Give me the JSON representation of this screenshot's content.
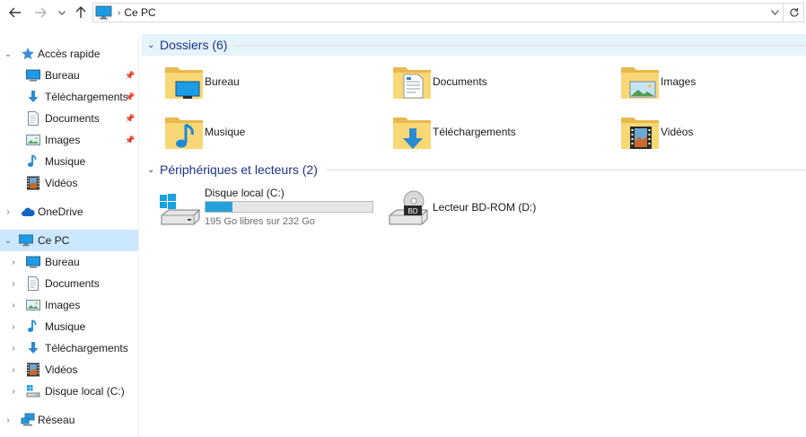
{
  "address": {
    "location": "Ce PC"
  },
  "nav": {
    "quick_access": "Accès rapide",
    "quick_items": [
      {
        "label": "Bureau",
        "icon": "desktop-icon"
      },
      {
        "label": "Téléchargements",
        "icon": "download-icon"
      },
      {
        "label": "Documents",
        "icon": "document-icon"
      },
      {
        "label": "Images",
        "icon": "pictures-icon"
      },
      {
        "label": "Musique",
        "icon": "music-icon"
      },
      {
        "label": "Vidéos",
        "icon": "videos-icon"
      }
    ],
    "onedrive": "OneDrive",
    "this_pc": "Ce PC",
    "pc_items": [
      {
        "label": "Bureau",
        "icon": "desktop-icon"
      },
      {
        "label": "Documents",
        "icon": "document-icon"
      },
      {
        "label": "Images",
        "icon": "pictures-icon"
      },
      {
        "label": "Musique",
        "icon": "music-icon"
      },
      {
        "label": "Téléchargements",
        "icon": "download-icon"
      },
      {
        "label": "Vidéos",
        "icon": "videos-icon"
      },
      {
        "label": "Disque local (C:)",
        "icon": "drive-icon"
      }
    ],
    "network": "Réseau"
  },
  "content": {
    "folders_header": "Dossiers (6)",
    "folders": [
      {
        "label": "Bureau",
        "icon": "desktop-folder-icon"
      },
      {
        "label": "Documents",
        "icon": "documents-folder-icon"
      },
      {
        "label": "Images",
        "icon": "pictures-folder-icon"
      },
      {
        "label": "Musique",
        "icon": "music-folder-icon"
      },
      {
        "label": "Téléchargements",
        "icon": "downloads-folder-icon"
      },
      {
        "label": "Vidéos",
        "icon": "videos-folder-icon"
      }
    ],
    "devices_header": "Périphériques et lecteurs (2)",
    "drive_c": {
      "name": "Disque local (C:)",
      "free": "195 Go libres sur 232 Go",
      "used_fraction": 0.16
    },
    "drive_d": {
      "name": "Lecteur BD-ROM (D:)",
      "badge": "BD"
    }
  },
  "colors": {
    "accent": "#26a0da",
    "header_text": "#1e3287",
    "selection": "#cce8ff",
    "folder": "#f8d775"
  }
}
